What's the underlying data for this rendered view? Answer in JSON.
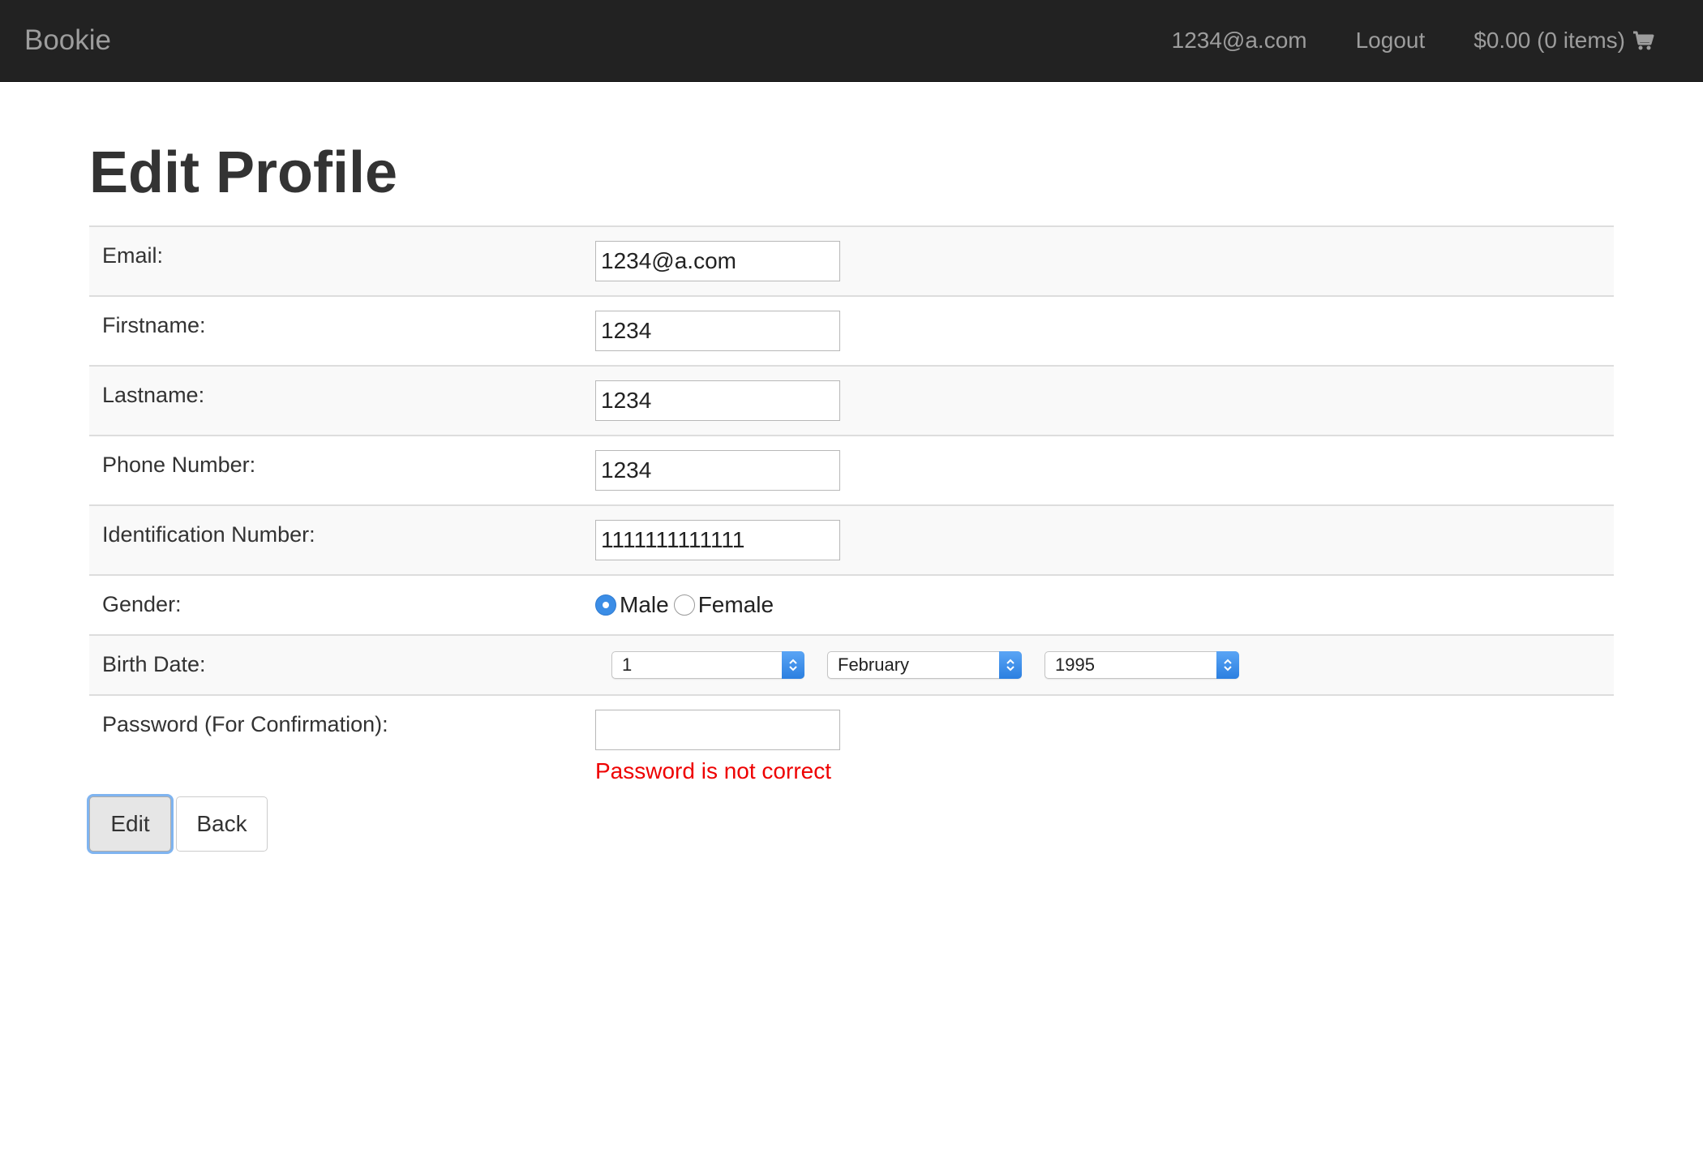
{
  "navbar": {
    "brand": "Bookie",
    "user_email": "1234@a.com",
    "logout": "Logout",
    "cart": "$0.00 (0 items)",
    "cart_icon": "shopping-cart-icon"
  },
  "page": {
    "title": "Edit Profile"
  },
  "form": {
    "email": {
      "label": "Email:",
      "value": "1234@a.com"
    },
    "firstname": {
      "label": "Firstname:",
      "value": "1234"
    },
    "lastname": {
      "label": "Lastname:",
      "value": "1234"
    },
    "phone": {
      "label": "Phone Number:",
      "value": "1234"
    },
    "id_number": {
      "label": "Identification Number:",
      "value": "1111111111111"
    },
    "gender": {
      "label": "Gender:",
      "options": [
        "Male",
        "Female"
      ],
      "selected": "Male"
    },
    "birth_date": {
      "label": "Birth Date:",
      "day": "1",
      "month": "February",
      "year": "1995"
    },
    "password": {
      "label": "Password (For Confirmation):",
      "value": "",
      "error": "Password is not correct"
    }
  },
  "buttons": {
    "edit": "Edit",
    "back": "Back"
  },
  "colors": {
    "navbar_bg": "#222222",
    "error": "#ee0000",
    "radio_accent": "#3b8de6"
  }
}
